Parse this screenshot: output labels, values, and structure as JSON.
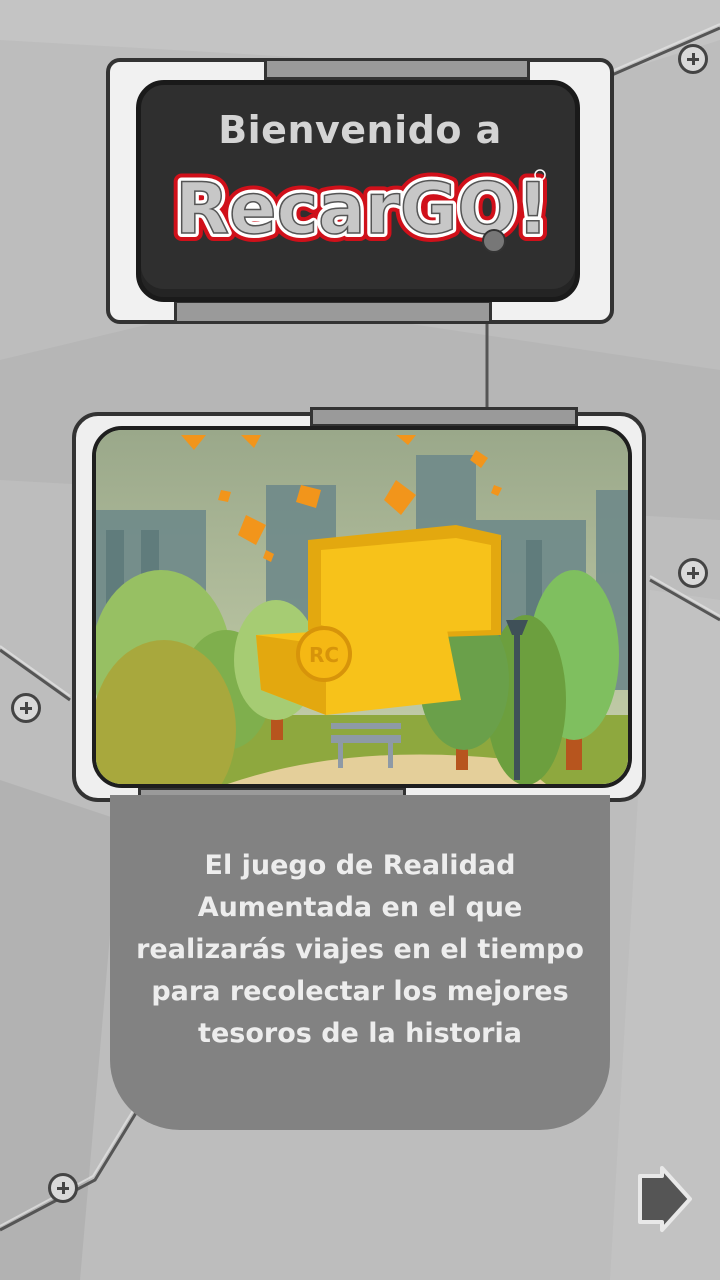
{
  "header": {
    "welcome_text": "Bienvenido a",
    "logo_text": "RecarGO!"
  },
  "hero_image": {
    "icon": "treasure-chest-city-park-illustration",
    "chest_emblem": "RC"
  },
  "description": {
    "lines": [
      "El juego de Realidad",
      "Aumentada en el que",
      "realizarás viajes en el tiempo",
      "para recolectar los mejores",
      "tesoros de la historia"
    ]
  },
  "navigation": {
    "next_icon": "arrow-right-icon"
  },
  "colors": {
    "background": "#bcbcbc",
    "panel": "#828282",
    "logo_red": "#d0101a",
    "chest_gold": "#f7c21a"
  }
}
